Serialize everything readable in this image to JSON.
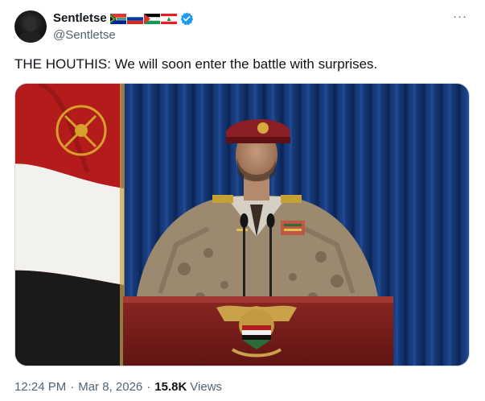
{
  "author": {
    "display_name": "Sentletse",
    "handle": "@Sentletse",
    "flags": [
      "south-africa-flag",
      "russia-flag",
      "palestine-flag",
      "lebanon-flag"
    ],
    "verified_icon": "verified-badge-icon",
    "verified_color": "#1d9bf0"
  },
  "more_label": "···",
  "tweet": {
    "text": "THE HOUTHIS: We will soon enter the battle with surprises."
  },
  "media": {
    "description_icon": "photo-image",
    "curtain_color": "#163a78",
    "podium_color": "#7a1d1a"
  },
  "meta": {
    "time": "12:24 PM",
    "separator": "·",
    "date": "Mar 8, 2026",
    "views_count": "15.8K",
    "views_label": "Views"
  }
}
